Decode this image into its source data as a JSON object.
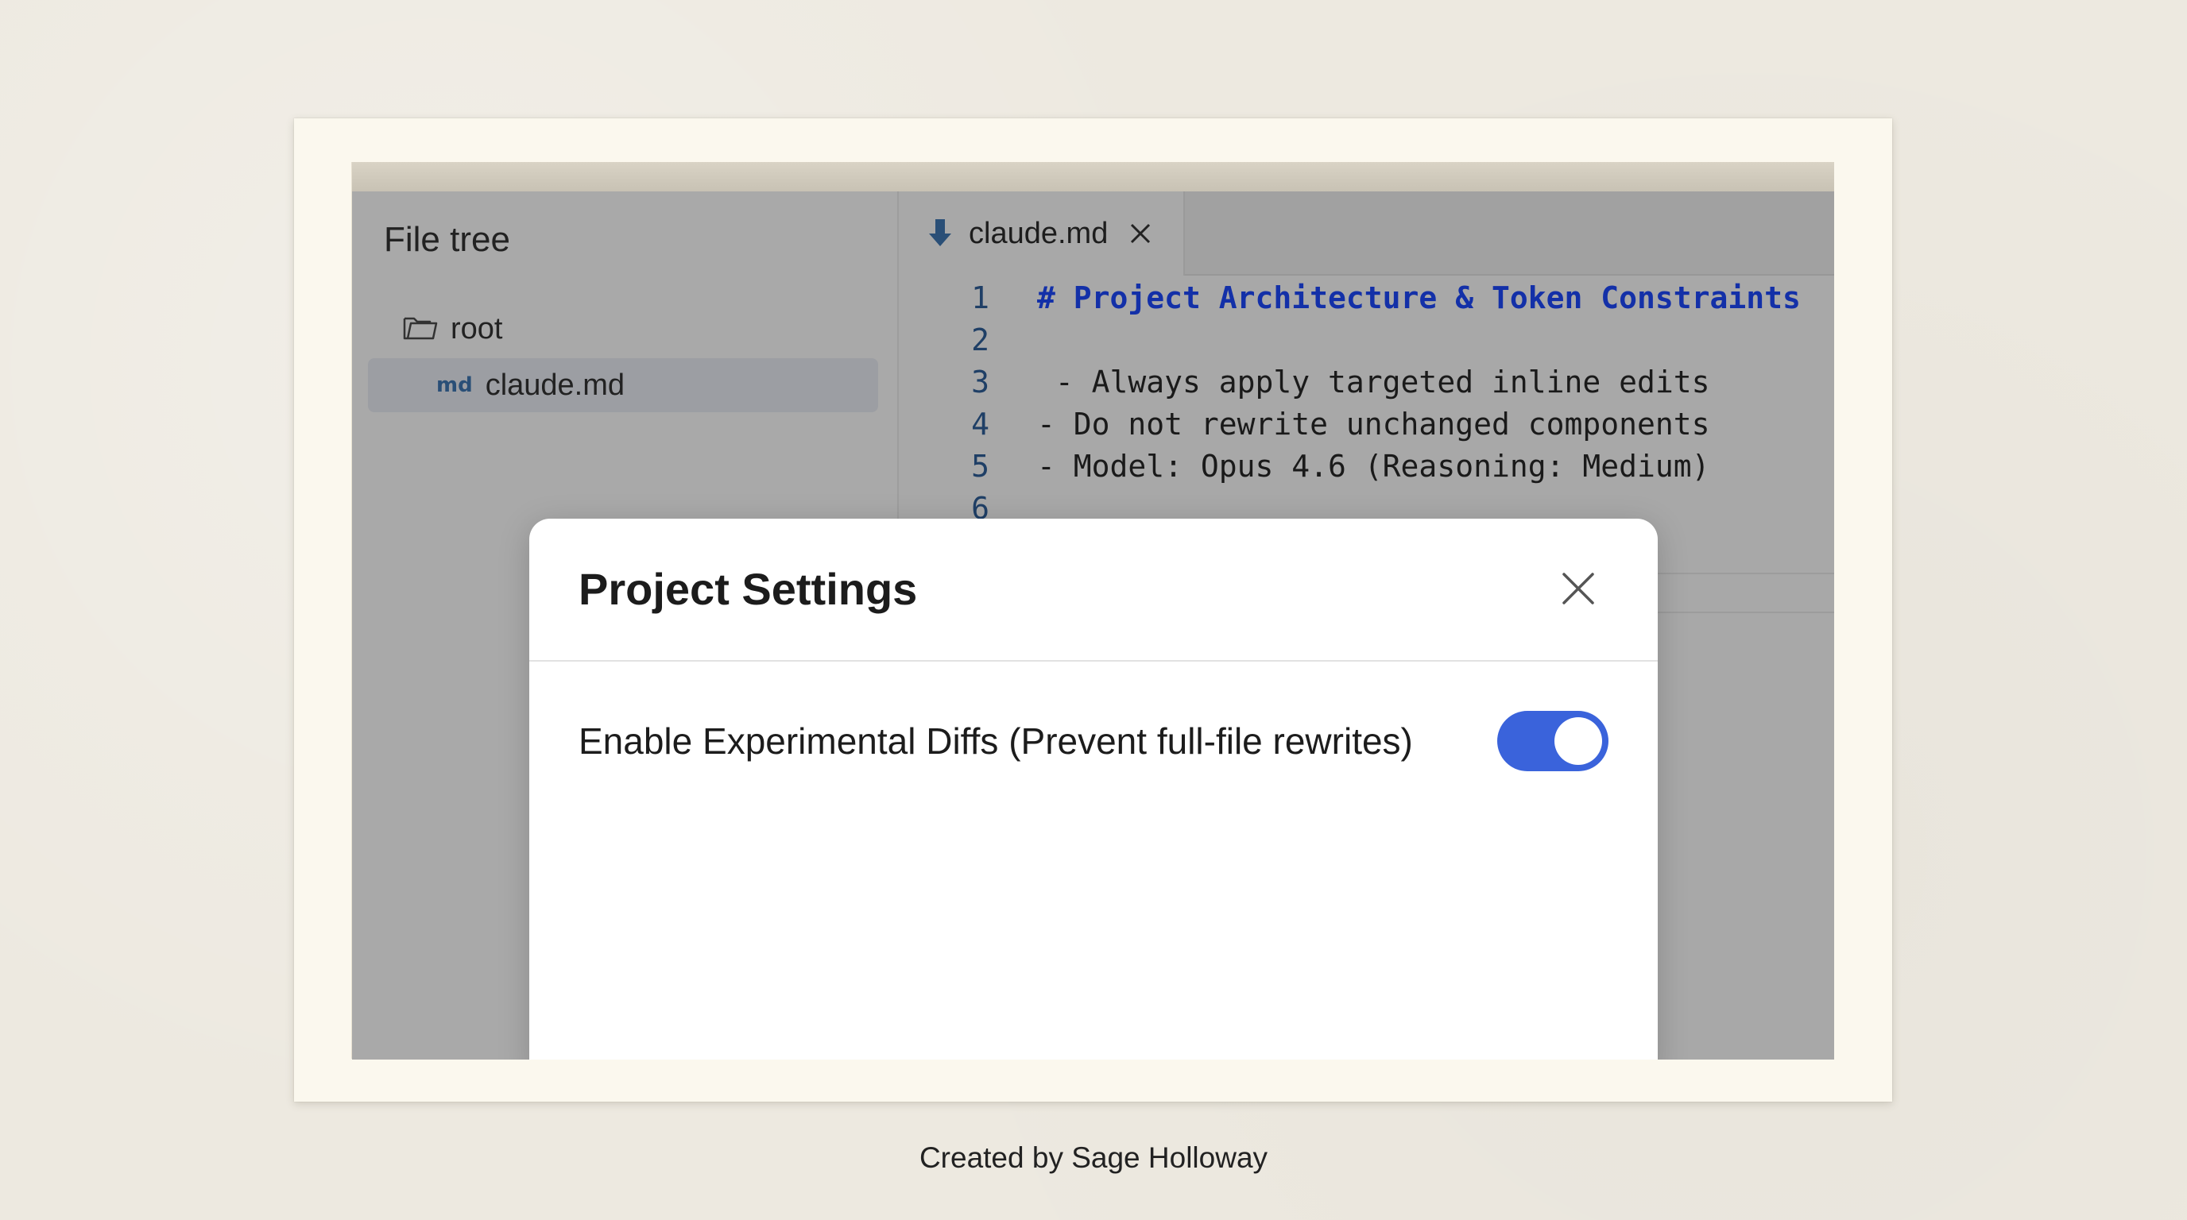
{
  "sidebar": {
    "title": "File tree",
    "items": [
      {
        "label": "root",
        "icon": "folder-icon"
      },
      {
        "label": "claude.md",
        "badge": "md",
        "selected": true
      }
    ]
  },
  "editor": {
    "tab": {
      "label": "claude.md",
      "icon": "download-arrow-icon",
      "close_icon": "close-icon"
    },
    "lines": [
      {
        "n": "1",
        "text": "# Project Architecture & Token Constraints"
      },
      {
        "n": "2",
        "text": ""
      },
      {
        "n": "3",
        "text": " - Always apply targeted inline edits"
      },
      {
        "n": "4",
        "text": "- Do not rewrite unchanged components"
      },
      {
        "n": "5",
        "text": "- Model: Opus 4.6 (Reasoning: Medium)"
      },
      {
        "n": "6",
        "text": ""
      }
    ]
  },
  "modal": {
    "title": "Project Settings",
    "close_icon": "close-icon",
    "settings": [
      {
        "label": "Enable Experimental Diffs (Prevent full-file rewrites)",
        "enabled": true
      }
    ]
  },
  "caption": "Created by Sage Holloway",
  "colors": {
    "accent": "#3a63db",
    "heading": "#1330a8",
    "line_numbers": "#1f3f66",
    "md_badge": "#2a4f77"
  }
}
